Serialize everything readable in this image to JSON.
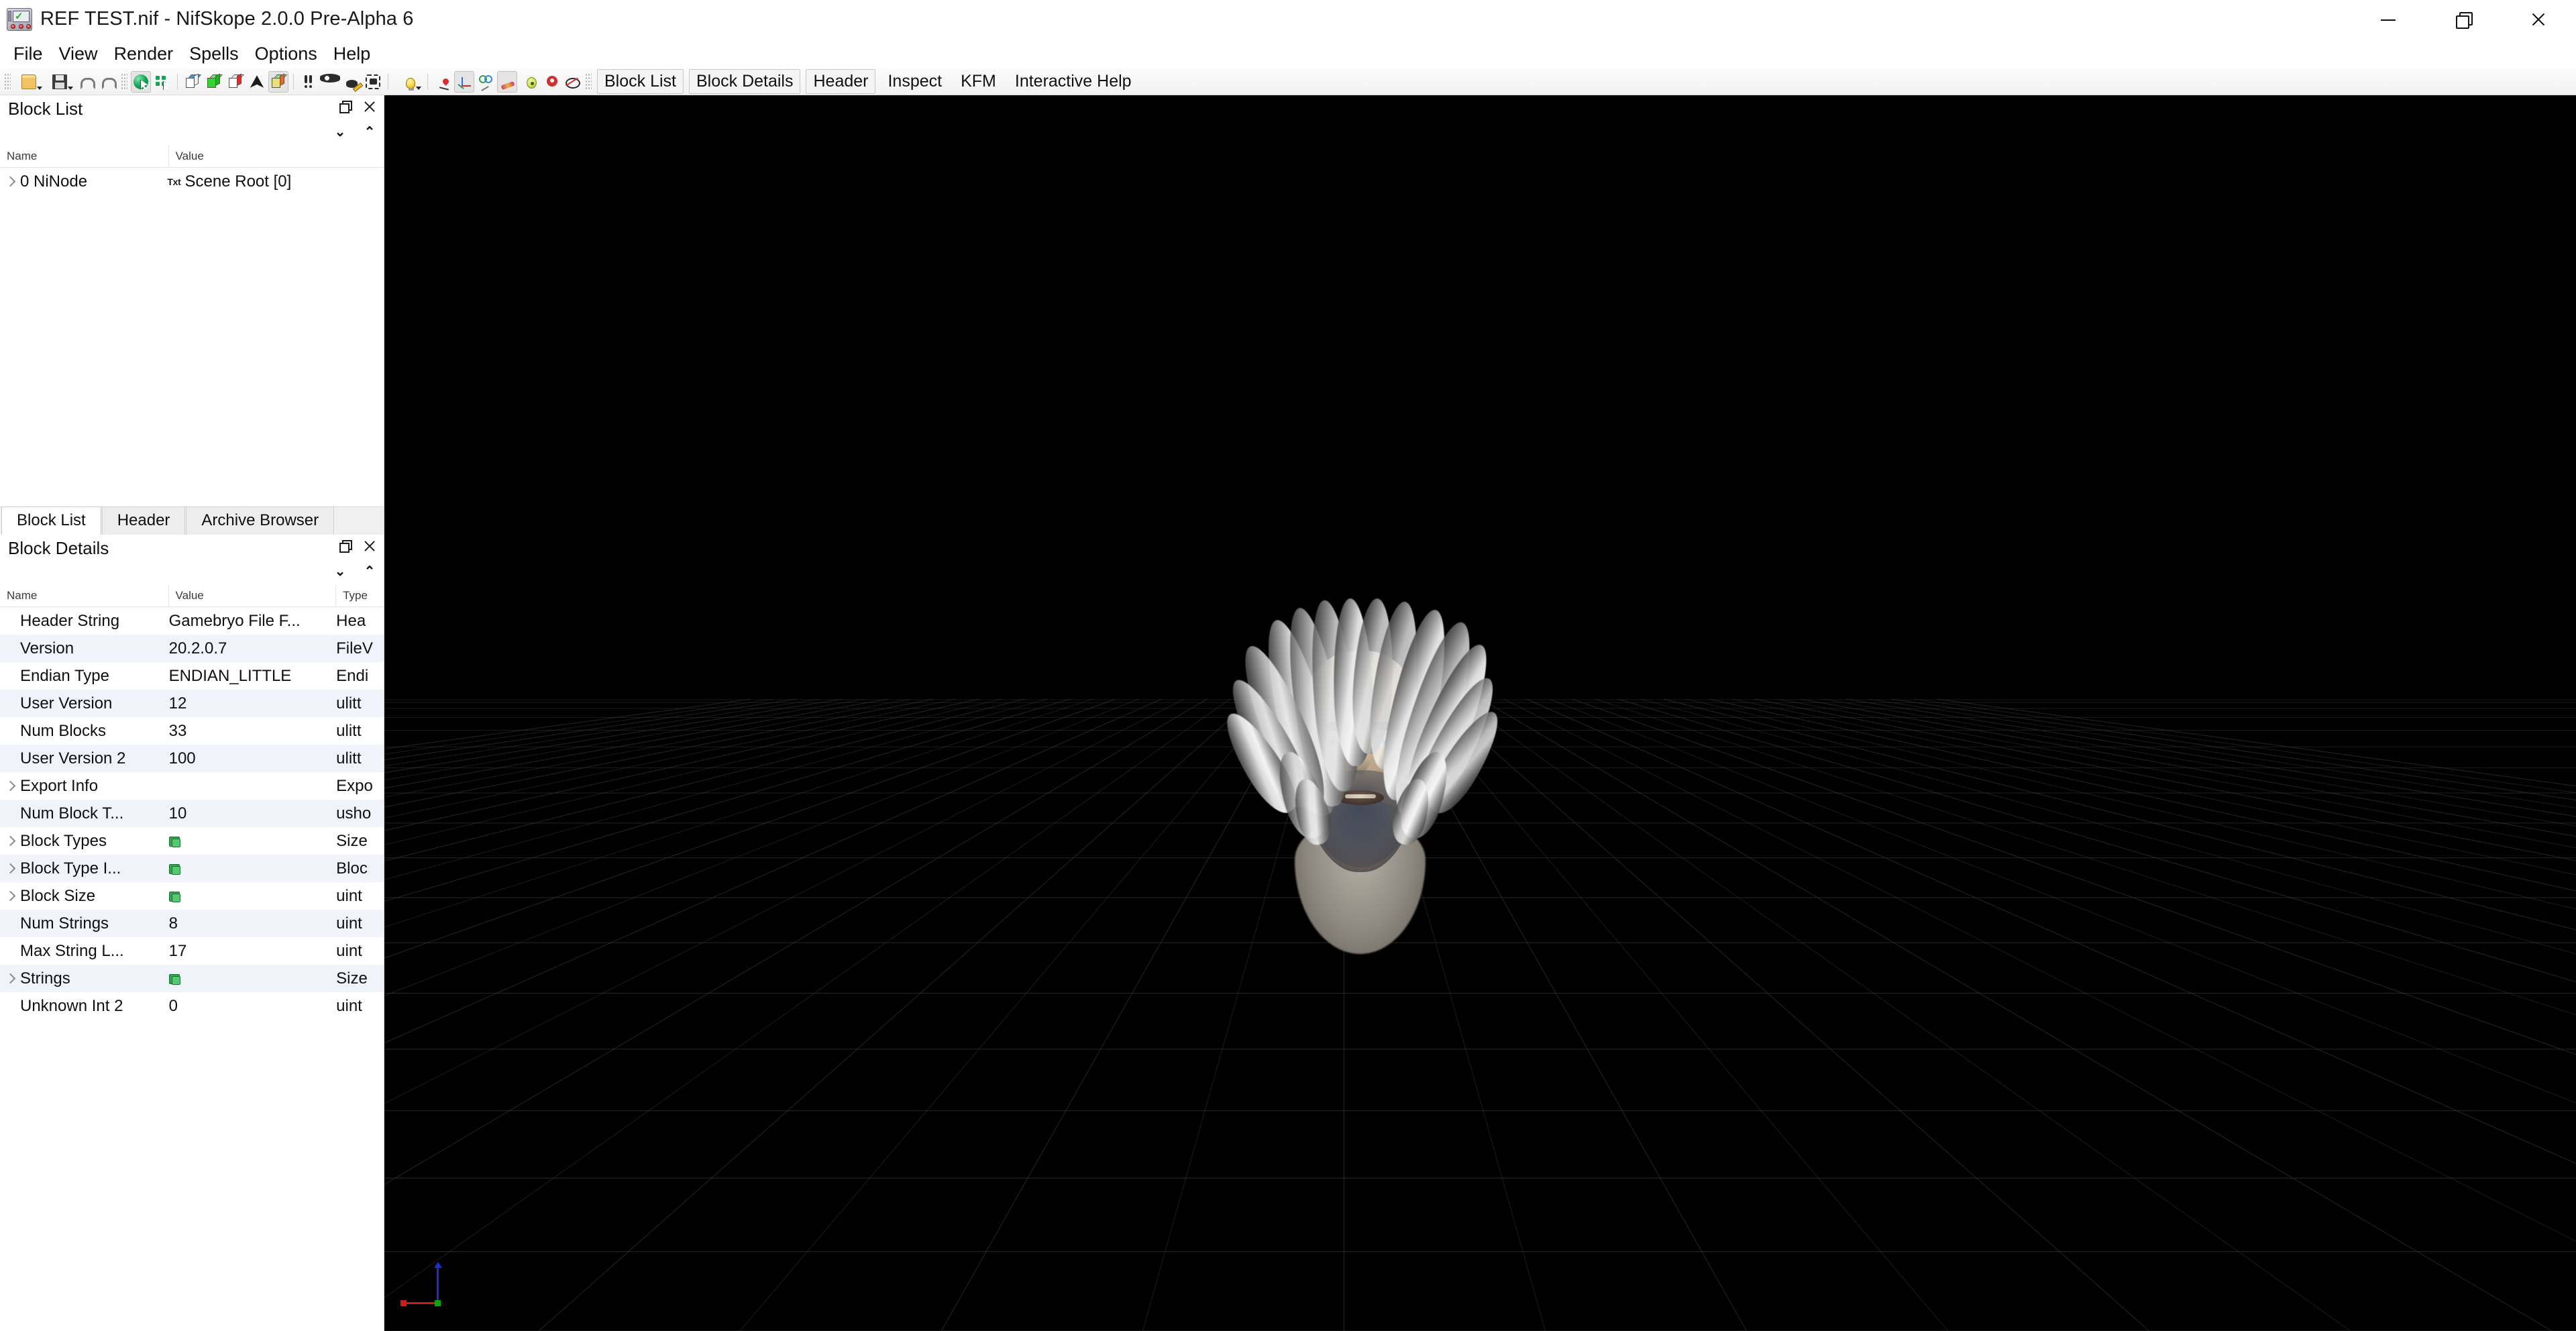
{
  "window": {
    "title": "REF TEST.nif - NifSkope 2.0.0 Pre-Alpha 6",
    "app_icon": "nifskope-logo-icon",
    "controls": {
      "minimize": "minimize-icon",
      "maximize": "restore-icon",
      "close": "close-icon"
    }
  },
  "menubar": {
    "items": [
      {
        "label": "File"
      },
      {
        "label": "View"
      },
      {
        "label": "Render"
      },
      {
        "label": "Spells"
      },
      {
        "label": "Options"
      },
      {
        "label": "Help"
      }
    ]
  },
  "toolbar": {
    "buttons": [
      {
        "name": "open-file-button",
        "icon": "folder-open-icon",
        "dropdown": true,
        "active": false
      },
      {
        "name": "save-file-button",
        "icon": "floppy-save-icon",
        "dropdown": true,
        "active": false
      },
      {
        "name": "undo-button",
        "icon": "undo-arrow-icon",
        "dropdown": false,
        "active": false
      },
      {
        "name": "redo-button",
        "icon": "redo-arrow-icon",
        "dropdown": false,
        "active": false
      },
      {
        "name": "select-object-button",
        "icon": "green-sphere-cursor-icon",
        "dropdown": false,
        "active": true
      },
      {
        "name": "select-vertex-button",
        "icon": "vertex-select-cursor-icon",
        "dropdown": false,
        "active": false
      },
      {
        "name": "show-bounding-box-button",
        "icon": "blue-top-cube-icon",
        "dropdown": false,
        "active": false
      },
      {
        "name": "show-solid-button",
        "icon": "green-cube-icon",
        "dropdown": false,
        "active": false
      },
      {
        "name": "show-wireframe-button",
        "icon": "red-side-cube-icon",
        "dropdown": false,
        "active": false
      },
      {
        "name": "show-normals-button",
        "icon": "dark-triangle-icon",
        "dropdown": false,
        "active": false
      },
      {
        "name": "show-textured-button",
        "icon": "multicolor-cube-icon",
        "dropdown": false,
        "active": true
      },
      {
        "name": "show-markers-button",
        "icon": "exclamation-pair-icon",
        "dropdown": false,
        "active": false
      },
      {
        "name": "show-hidden-button",
        "icon": "eye-icon",
        "dropdown": false,
        "active": false
      },
      {
        "name": "edit-visibility-button",
        "icon": "eye-pencil-icon",
        "dropdown": false,
        "active": false
      },
      {
        "name": "screenshot-button",
        "icon": "camera-icon",
        "dropdown": false,
        "active": false
      },
      {
        "name": "lighting-button",
        "icon": "lightbulb-icon",
        "dropdown": true,
        "active": false
      },
      {
        "name": "show-axes-marker-button",
        "icon": "pin-marker-icon",
        "dropdown": false,
        "active": false
      },
      {
        "name": "show-axes-button",
        "icon": "xyz-axes-icon",
        "dropdown": false,
        "active": true
      },
      {
        "name": "show-constraints-button",
        "icon": "constraints-icon",
        "dropdown": false,
        "active": false
      },
      {
        "name": "show-bones-button",
        "icon": "bone-icon",
        "dropdown": false,
        "active": true
      },
      {
        "name": "show-nodes-button",
        "icon": "node-sphere-icon",
        "dropdown": false,
        "active": false
      },
      {
        "name": "show-furniture-markers-button",
        "icon": "red-pin-icon",
        "dropdown": false,
        "active": false
      },
      {
        "name": "hide-nodes-button",
        "icon": "node-crossed-out-icon",
        "dropdown": false,
        "active": false
      }
    ],
    "tabs": [
      {
        "label": "Block List",
        "framed": true
      },
      {
        "label": "Block Details",
        "framed": true
      },
      {
        "label": "Header",
        "framed": true
      },
      {
        "label": "Inspect",
        "framed": false
      },
      {
        "label": "KFM",
        "framed": false
      },
      {
        "label": "Interactive Help",
        "framed": false
      }
    ]
  },
  "block_list_panel": {
    "title": "Block List",
    "float_icon": "float-panel-icon",
    "close_icon": "close-panel-icon",
    "expand_all_icon": "expand-all-chevron-icon",
    "collapse_all_icon": "collapse-all-chevron-icon",
    "columns": {
      "name": "Name",
      "value": "Value"
    },
    "rows": [
      {
        "expandable": true,
        "name": "0 NiNode",
        "value_badge": "Txt",
        "value": "Scene Root [0]"
      }
    ]
  },
  "sidebar_tabs": [
    {
      "label": "Block List",
      "active": true
    },
    {
      "label": "Header",
      "active": false
    },
    {
      "label": "Archive Browser",
      "active": false
    }
  ],
  "block_details_panel": {
    "title": "Block Details",
    "float_icon": "float-panel-icon",
    "close_icon": "close-panel-icon",
    "expand_all_icon": "expand-all-chevron-icon",
    "collapse_all_icon": "collapse-all-chevron-icon",
    "columns": {
      "name": "Name",
      "value": "Value",
      "type": "Type"
    },
    "rows": [
      {
        "expandable": false,
        "name": "Header String",
        "value": "Gamebryo File F...",
        "type": "Hea"
      },
      {
        "expandable": false,
        "name": "Version",
        "value": "20.2.0.7",
        "type": "FileV"
      },
      {
        "expandable": false,
        "name": "Endian Type",
        "value": "ENDIAN_LITTLE",
        "type": "Endi"
      },
      {
        "expandable": false,
        "name": "User Version",
        "value": "12",
        "type": "ulitt"
      },
      {
        "expandable": false,
        "name": "Num Blocks",
        "value": "33",
        "type": "ulitt"
      },
      {
        "expandable": false,
        "name": "User Version 2",
        "value": "100",
        "type": "ulitt"
      },
      {
        "expandable": true,
        "name": "Export Info",
        "value": "",
        "type": "Expo"
      },
      {
        "expandable": false,
        "name": "Num Block T...",
        "value": "10",
        "type": "usho"
      },
      {
        "expandable": true,
        "name": "Block Types",
        "value": "",
        "value_icon": "array-icon",
        "type": "Size"
      },
      {
        "expandable": true,
        "name": "Block Type I...",
        "value": "",
        "value_icon": "array-icon",
        "type": "Bloc"
      },
      {
        "expandable": true,
        "name": "Block Size",
        "value": "",
        "value_icon": "array-icon",
        "type": "uint"
      },
      {
        "expandable": false,
        "name": "Num Strings",
        "value": "8",
        "type": "uint"
      },
      {
        "expandable": false,
        "name": "Max String L...",
        "value": "17",
        "type": "uint"
      },
      {
        "expandable": true,
        "name": "Strings",
        "value": "",
        "value_icon": "array-icon",
        "type": "Size"
      },
      {
        "expandable": false,
        "name": "Unknown Int 2",
        "value": "0",
        "type": "uint"
      }
    ]
  },
  "viewport": {
    "background_color": "#000000",
    "grid_color": "#3a3a3a",
    "model_name": "character-head-model",
    "gizmo": {
      "x_axis_color": "#c81e1e",
      "y_axis_color": "#13a013",
      "z_axis_color": "#1b2fd0"
    }
  }
}
